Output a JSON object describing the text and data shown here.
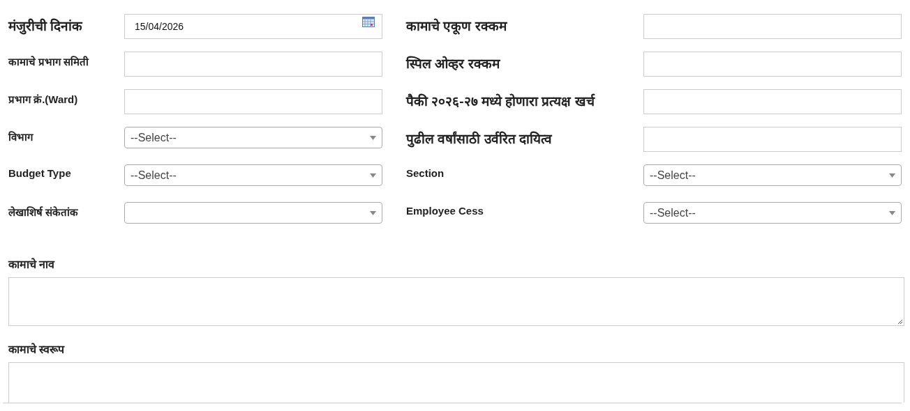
{
  "left_fields": [
    {
      "label": "मंजुरीची दिनांक",
      "kind": "date",
      "value": "15/04/2026"
    },
    {
      "label": "कामाचे प्रभाग समिती",
      "kind": "text"
    },
    {
      "label": "प्रभाग क्रं.(Ward)",
      "kind": "text"
    },
    {
      "label": "विभाग",
      "kind": "select",
      "value": "--Select--"
    },
    {
      "label": "Budget Type",
      "kind": "select",
      "value": "--Select--"
    },
    {
      "label": "लेखाशिर्ष संकेतांक",
      "kind": "select"
    }
  ],
  "right_fields": [
    {
      "label": "कामाचे एकूण रक्कम",
      "kind": "text"
    },
    {
      "label": "स्पिल ओव्हर रक्कम",
      "kind": "text"
    },
    {
      "label": "पैकी २०२६-२७ मध्ये होणारा प्रत्यक्ष खर्च",
      "kind": "text"
    },
    {
      "label": "पुढील वर्षांसाठी उर्वरित दायित्व",
      "kind": "text"
    },
    {
      "label": "Section",
      "kind": "select",
      "value": "--Select--"
    },
    {
      "label": "Employee Cess",
      "kind": "select",
      "value": "--Select--"
    }
  ],
  "text_areas": [
    {
      "label": "कामाचे नाव"
    },
    {
      "label": "कामाचे स्वरूप"
    }
  ]
}
